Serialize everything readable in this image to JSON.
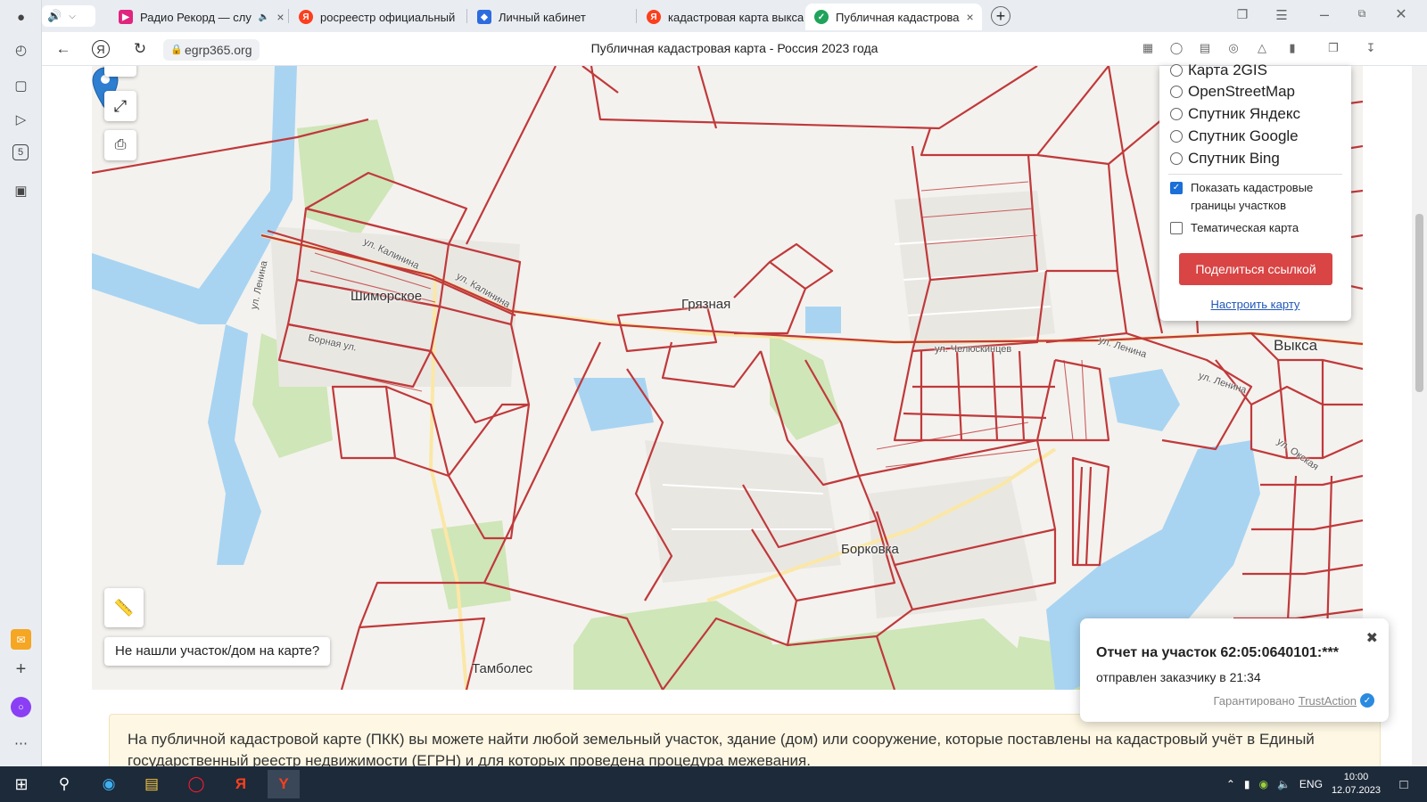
{
  "browser": {
    "tabs": [
      {
        "title": "Радио Рекорд — слу",
        "icon": "radio-record-icon",
        "color": "#e0257e"
      },
      {
        "title": "росреестр официальный",
        "icon": "yandex-icon",
        "color": "#fc3f1d"
      },
      {
        "title": "Личный кабинет",
        "icon": "cabinet-icon",
        "color": "#2d6cdf"
      },
      {
        "title": "кадастровая карта выкса",
        "icon": "yandex-icon",
        "color": "#fc3f1d"
      },
      {
        "title": "Публичная кадастрова",
        "icon": "check-icon",
        "color": "#20a35a"
      }
    ],
    "url": "egrp365.org",
    "page_title": "Публичная кадастровая карта - Россия 2023 года"
  },
  "map": {
    "layers": {
      "radio_options": [
        "Карта 2GIS",
        "OpenStreetMap",
        "Спутник Яндекс",
        "Спутник Google",
        "Спутник Bing"
      ],
      "show_borders": "Показать кадастровые границы участков",
      "show_borders_checked": true,
      "thematic": "Тематическая карта",
      "thematic_checked": false,
      "share_label": "Поделиться ссылкой",
      "setup_link": "Настроить карту"
    },
    "not_found_label": "Не нашли участок/дом на карте?",
    "place_labels": {
      "shimorskoe": "Шиморское",
      "gryaznaya": "Грязная",
      "vyksa": "Выкса",
      "borkovka": "Борковка",
      "tambolez": "Тамболес"
    },
    "street_labels": {
      "lenina_w": "ул. Ленина",
      "kalinina1": "ул. Калинина",
      "kalinina2": "ул. Калинина",
      "bornaya": "Борная ул.",
      "chelyuskintsev": "ул. Челюскинцев",
      "lenina_e": "ул. Ленина",
      "lenina_e2": "ул. Ленина",
      "okskaya": "ул. Окская"
    }
  },
  "toast": {
    "title": "Отчет на участок 62:05:0640101:***",
    "subtitle": "отправлен заказчику в 21:34",
    "guarantee": "Гарантировано",
    "brand": "TrustAction"
  },
  "info_text": "На публичной кадастровой карте (ПКК) вы можете найти любой земельный участок, здание (дом) или сооружение, которые поставлены на кадастровый учёт в Единый государственный реестр недвижимости (ЕГРН) и для которых проведена процедура межевания.",
  "taskbar": {
    "lang": "ENG",
    "time": "10:00",
    "date": "12.07.2023"
  }
}
